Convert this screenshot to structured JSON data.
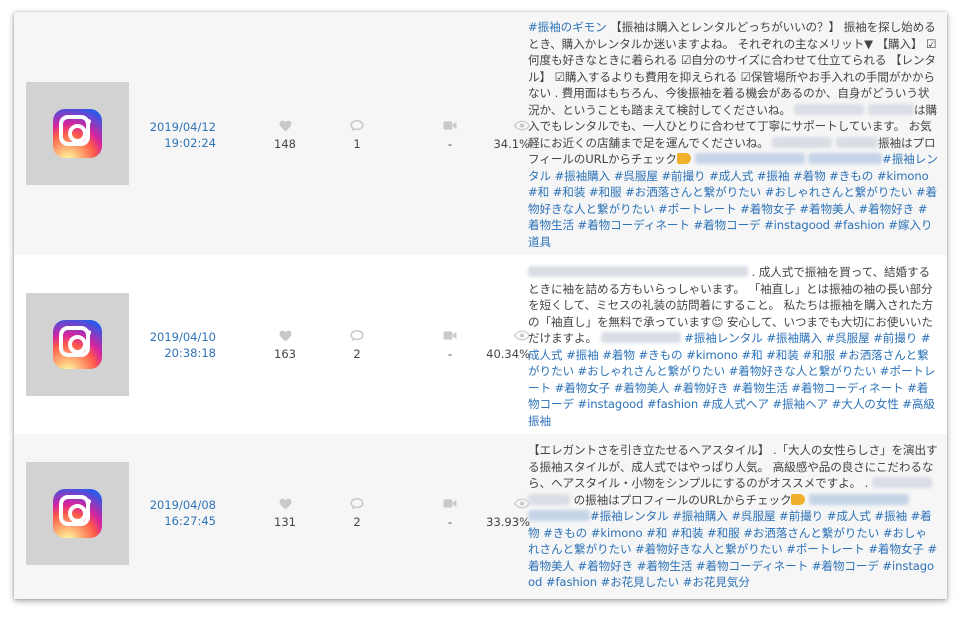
{
  "posts": [
    {
      "date": "2019/04/12",
      "time": "19:02:24",
      "likes": "148",
      "comments": "1",
      "video": "-",
      "rate": "34.1%",
      "caption": [
        {
          "tag": true,
          "text": "#振袖のギモン"
        },
        {
          "text": " 【振袖は購入とレンタルどっちがいいの？】 振袖を探し始めるとき、購入かレンタルか迷いますよね。 それぞれの主なメリット▼ 【購入】 ☑何度も好きなときに着られる ☑自分のサイズに合わせて仕立てられる 【レンタル】 ☑購入するよりも費用を抑えられる ☑保管場所やお手入れの手間がかからない . 費用面はもちろん、今後振袖を着る機会があるのか、自身がどういう状況か、ということも踏まえて検討してくださいね。 "
        },
        {
          "blur": 70
        },
        {
          "text": " "
        },
        {
          "blur": 46
        },
        {
          "text": "は購入でもレンタルでも、一人ひとりに合わせて丁寧にサポートしています。 お気軽にお近くの店舗まで足を運んでくださいね。 "
        },
        {
          "blur": 60
        },
        {
          "text": " "
        },
        {
          "blur": 42
        },
        {
          "text": "振袖はプロフィールのURLからチェック"
        },
        {
          "hand": true
        },
        {
          "text": " "
        },
        {
          "blur": 110,
          "blue": true
        },
        {
          "text": " "
        },
        {
          "blur": 74,
          "blue": true
        },
        {
          "tag": true,
          "text": "#振袖レンタル #振袖購入 #呉服屋 #前撮り #成人式 #振袖 #着物 #きもの #kimono #和 #和装 #和服 #お洒落さんと繋がりたい #おしゃれさんと繋がりたい #着物好きな人と繋がりたい #ポートレート #着物女子 #着物美人 #着物好き #着物生活 #着物コーディネート #着物コーデ #instagood #fashion #嫁入り道具"
        }
      ]
    },
    {
      "date": "2019/04/10",
      "time": "20:38:18",
      "likes": "163",
      "comments": "2",
      "video": "-",
      "rate": "40.34%",
      "caption": [
        {
          "blur": 220
        },
        {
          "text": " . 成人式で振袖を買って、結婚するときに袖を詰める方もいらっしゃいます。 「袖直し」とは振袖の袖の長い部分を短くして、ミセスの礼装の訪問着にすること。 私たちは振袖を購入された方の「袖直し」を無料で承っています☺ 安心して、いつまでも大切にお使いいただけますよ。 "
        },
        {
          "blur": 80
        },
        {
          "text": " "
        },
        {
          "tag": true,
          "text": "#振袖レンタル #振袖購入 #呉服屋 #前撮り #成人式 #振袖 #着物 #きもの #kimono #和 #和装 #和服 #お洒落さんと繋がりたい #おしゃれさんと繋がりたい #着物好きな人と繋がりたい #ポートレート #着物女子 #着物美人 #着物好き #着物生活 #着物コーディネート #着物コーデ #instagood #fashion #成人式ヘア #振袖ヘア #大人の女性 #高級振袖"
        }
      ]
    },
    {
      "date": "2019/04/08",
      "time": "16:27:45",
      "likes": "131",
      "comments": "2",
      "video": "-",
      "rate": "33.93%",
      "caption": [
        {
          "text": "【エレガントさを引き立たせるヘアスタイル】 .「大人の女性らしさ」を演出する振袖スタイルが、成人式ではやっぱり人気。 高級感や品の良さにこだわるなら、ヘアスタイル・小物をシンプルにするのがオススメですよ。 . "
        },
        {
          "blur": 60
        },
        {
          "text": " "
        },
        {
          "blur": 42
        },
        {
          "text": " の振袖はプロフィールのURLからチェック"
        },
        {
          "hand": true
        },
        {
          "text": " "
        },
        {
          "blur": 100,
          "blue": true
        },
        {
          "text": " "
        },
        {
          "blur": 62,
          "blue": true
        },
        {
          "tag": true,
          "text": "#振袖レンタル #振袖購入 #呉服屋 #前撮り #成人式 #振袖 #着物 #きもの #kimono #和 #和装 #和服 #お洒落さんと繋がりたい #おしゃれさんと繋がりたい #着物好きな人と繋がりたい #ポートレート #着物女子 #着物美人 #着物好き #着物生活 #着物コーディネート #着物コーデ #instagood #fashion #お花見したい #お花見気分"
        }
      ]
    }
  ]
}
